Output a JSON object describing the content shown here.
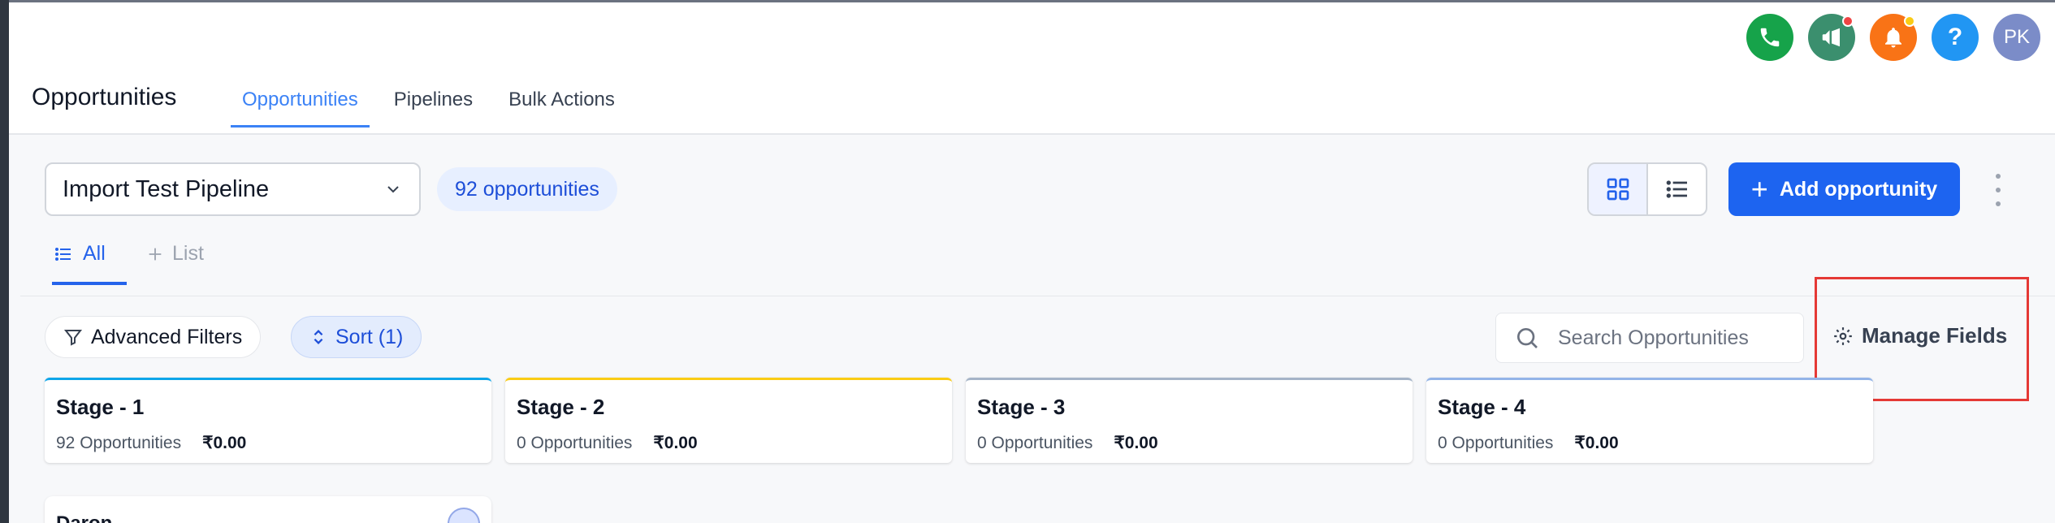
{
  "header": {
    "title": "Opportunities",
    "tabs": [
      {
        "label": "Opportunities",
        "active": true
      },
      {
        "label": "Pipelines",
        "active": false
      },
      {
        "label": "Bulk Actions",
        "active": false
      }
    ],
    "user_initials": "PK",
    "help_glyph": "?",
    "icons": [
      "phone-icon",
      "megaphone-icon",
      "bell-icon",
      "help-icon",
      "avatar"
    ]
  },
  "toolbar": {
    "pipeline": "Import Test Pipeline",
    "count": "92 opportunities",
    "add_label": "Add opportunity"
  },
  "subtabs": {
    "all": "All",
    "list": "List"
  },
  "filters": {
    "advanced": "Advanced Filters",
    "sort": "Sort (1)",
    "search_placeholder": "Search Opportunities",
    "manage_fields": "Manage Fields"
  },
  "stages": [
    {
      "name": "Stage - 1",
      "count": "92 Opportunities",
      "amount": "₹0.00",
      "color": "#0ea5e9"
    },
    {
      "name": "Stage - 2",
      "count": "0 Opportunities",
      "amount": "₹0.00",
      "color": "#facc15"
    },
    {
      "name": "Stage - 3",
      "count": "0 Opportunities",
      "amount": "₹0.00",
      "color": "#a5b4c8"
    },
    {
      "name": "Stage - 4",
      "count": "0 Opportunities",
      "amount": "₹0.00",
      "color": "#93b4e8"
    }
  ],
  "cards": [
    {
      "title": "Daron"
    }
  ],
  "colors": {
    "primary": "#1d64f0",
    "accent_tab": "#3b82f6",
    "highlight": "#e53935"
  }
}
